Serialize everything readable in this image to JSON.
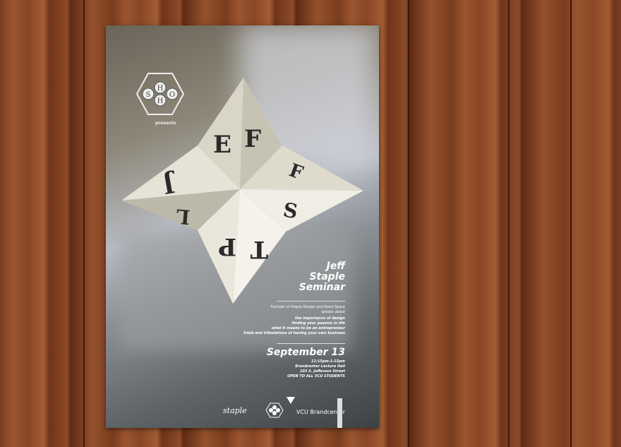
{
  "poster": {
    "logo_letters": "SHHO",
    "presents": "presents",
    "title_lines": [
      "Jeff",
      "Staple",
      "Seminar"
    ],
    "intro_lines": [
      "Founder of Staple Design and Reed Space",
      "speaks about"
    ],
    "topics": [
      "the importance of design",
      "finding your passion in life",
      "what it means to be an entrepreneur",
      "trials and tribulations of having your own business"
    ],
    "date": "September 13",
    "details": [
      "12:15pm-1:15pm",
      "Brandcenter Lecture Hall",
      "103 S. Jefferson Street",
      "OPEN TO ALL VCU STUDENTS"
    ],
    "sponsors": {
      "staple": "staple",
      "vcu": "VCU Brandcenter"
    },
    "fortune_teller_letters": {
      "top": [
        "E",
        "F"
      ],
      "left": [
        "J",
        "L"
      ],
      "right": [
        "F",
        "S"
      ],
      "bottom": [
        "T",
        "P"
      ]
    }
  }
}
